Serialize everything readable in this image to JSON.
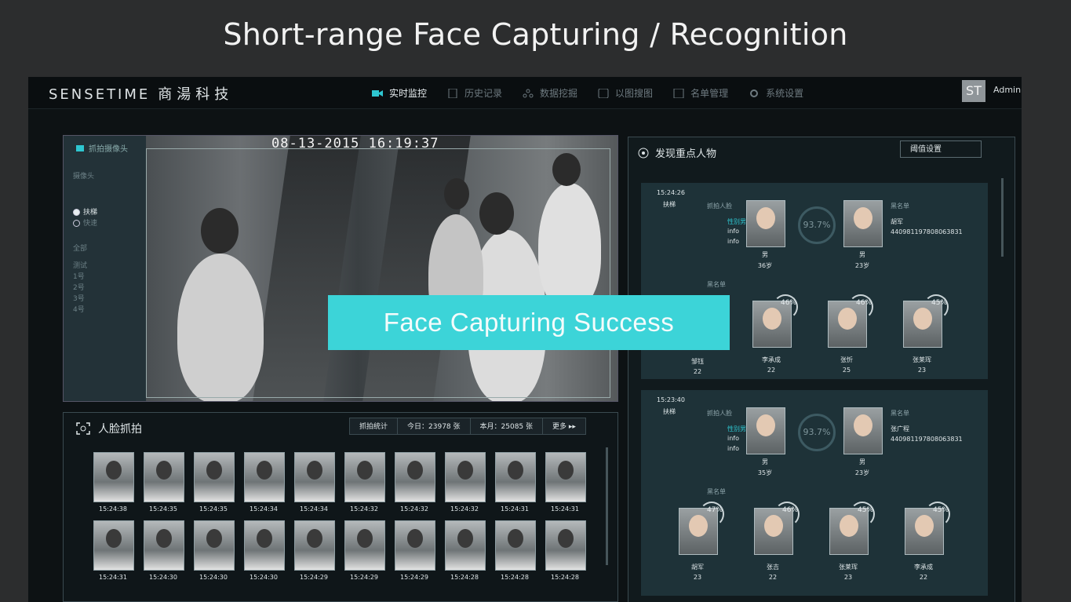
{
  "slide_title": "Short-range Face Capturing / Recognition",
  "overlay_text": "Face Capturing Success",
  "app": {
    "logo_en": "SENSETIME",
    "logo_cn": "商湯科技",
    "nav": [
      "实时监控",
      "历史记录",
      "数据挖掘",
      "以图搜图",
      "名单管理",
      "系统设置"
    ],
    "avatar_text": "ST",
    "user": "Admin"
  },
  "video": {
    "timestamp": "08-13-2015 16:19:37",
    "side_items": [
      "抓拍摄像头",
      "摄像头",
      "扶梯",
      "快速",
      "全部",
      "测试",
      "1号",
      "2号",
      "3号",
      "4号"
    ]
  },
  "capture": {
    "title": "人脸抓拍",
    "stats_label": "抓拍统计",
    "today": "今日：23978 张",
    "month": "本月：25085 张",
    "more": "更多 ▸▸",
    "times": [
      "15:24:38",
      "15:24:35",
      "15:24:35",
      "15:24:34",
      "15:24:34",
      "15:24:32",
      "15:24:32",
      "15:24:32",
      "15:24:31",
      "15:24:31",
      "15:24:31",
      "15:24:30",
      "15:24:30",
      "15:24:30",
      "15:24:29",
      "15:24:29",
      "15:24:29",
      "15:24:28",
      "15:24:28",
      "15:24:28"
    ]
  },
  "alerts": {
    "title": "发现重点人物",
    "threshold_label": "阈值设置",
    "cards": [
      {
        "time": "15:24:26",
        "tag": "扶梯",
        "capture_label": "抓拍人脸",
        "info": [
          "性别男",
          "info",
          "info"
        ],
        "score": "93.7%",
        "left_gender": "男",
        "left_age": "36岁",
        "right_gender": "男",
        "right_age": "23岁",
        "list_label": "黑名单",
        "right_name": "胡军",
        "id": "440981197808063831",
        "matches": [
          {
            "pct": "46%",
            "name": "李承成",
            "age": "22"
          },
          {
            "pct": "46%",
            "name": "张忻",
            "age": "25"
          },
          {
            "pct": "45%",
            "name": "张莱珲",
            "age": "23"
          }
        ],
        "first_name": "邹钰",
        "first_age": "22"
      },
      {
        "time": "15:23:40",
        "tag": "扶梯",
        "capture_label": "抓拍人脸",
        "info": [
          "性别男",
          "info",
          "info"
        ],
        "score": "93.7%",
        "left_gender": "男",
        "left_age": "35岁",
        "right_gender": "男",
        "right_age": "23岁",
        "list_label": "黑名单",
        "right_name": "张广程",
        "id": "440981197808063831",
        "matches": [
          {
            "pct": "47%",
            "name": "胡军",
            "age": "23"
          },
          {
            "pct": "46%",
            "name": "张吉",
            "age": "22"
          },
          {
            "pct": "45%",
            "name": "张莱珲",
            "age": "23"
          },
          {
            "pct": "45%",
            "name": "李承成",
            "age": "22"
          }
        ]
      }
    ]
  },
  "colors": {
    "accent": "#3cd4d8",
    "panel": "#1e3238"
  }
}
